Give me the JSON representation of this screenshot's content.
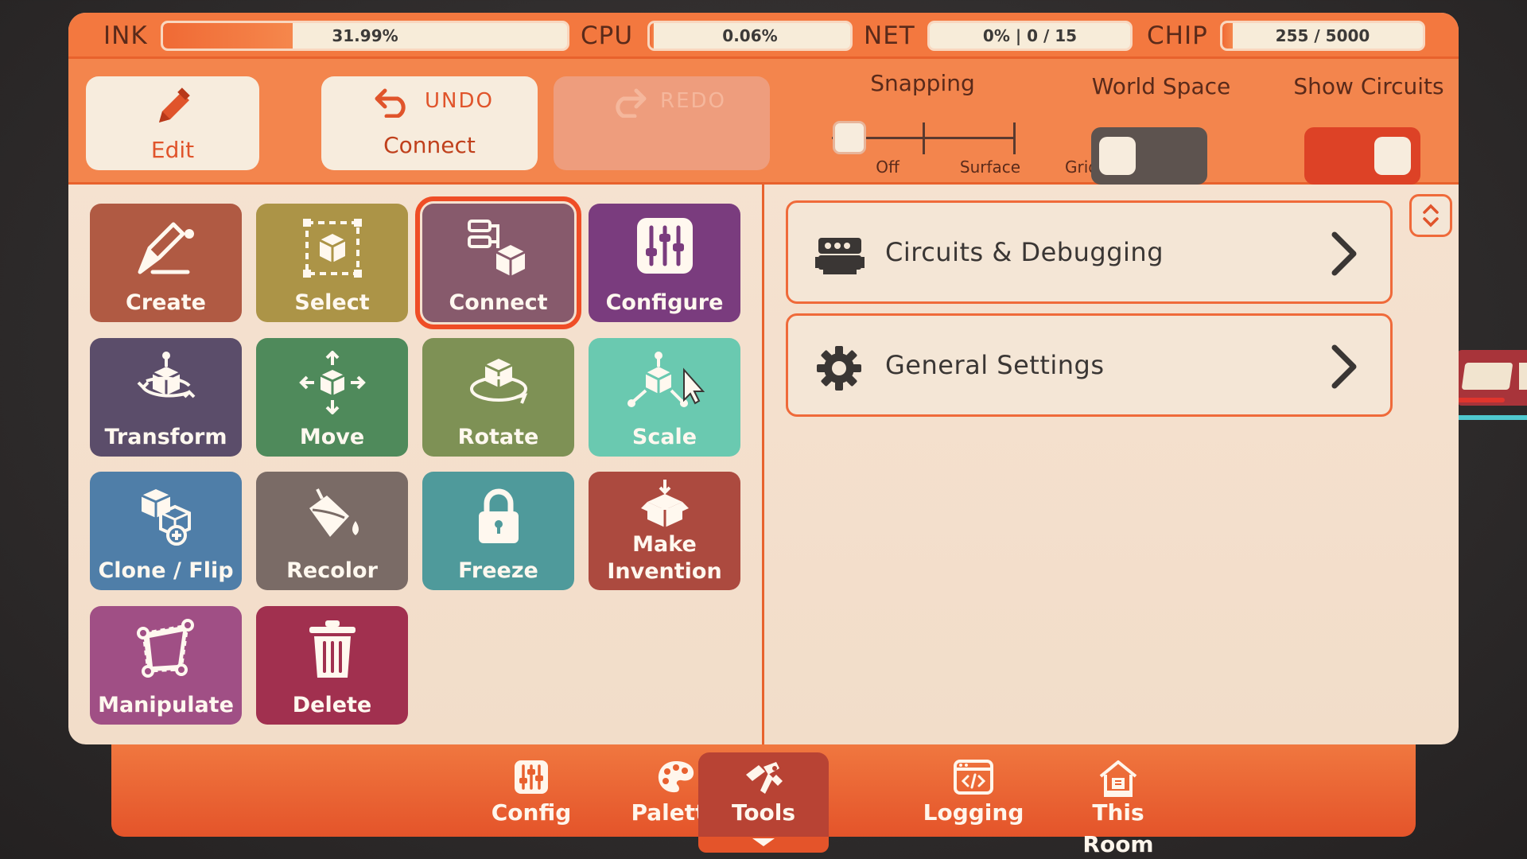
{
  "meters": {
    "ink": {
      "label": "INK",
      "value": "31.99%",
      "fill": 0.32
    },
    "cpu": {
      "label": "CPU",
      "value": "0.06%",
      "fill": 0.02
    },
    "net": {
      "label": "NET",
      "value": "0% | 0 / 15",
      "fill": 0.0
    },
    "chip": {
      "label": "CHIP",
      "value": "255 / 5000",
      "fill": 0.051
    }
  },
  "toolbar": {
    "edit_label": "Edit",
    "undo_label": "UNDO",
    "undo_action": "Connect",
    "redo_label": "REDO",
    "snapping": {
      "title": "Snapping",
      "options": [
        "Off",
        "Surface",
        "Grid"
      ],
      "selected": "Off"
    },
    "world_space": {
      "label": "World Space",
      "on": false
    },
    "show_circuits": {
      "label": "Show Circuits",
      "on": true
    }
  },
  "tools": [
    {
      "label": "Create",
      "color": "#b05a43"
    },
    {
      "label": "Select",
      "color": "#ac9447"
    },
    {
      "label": "Connect",
      "color": "#875a6c",
      "selected": true
    },
    {
      "label": "Configure",
      "color": "#7a3c7e"
    },
    {
      "label": "Transform",
      "color": "#5b4d6a"
    },
    {
      "label": "Move",
      "color": "#4f8a5b"
    },
    {
      "label": "Rotate",
      "color": "#7e9155"
    },
    {
      "label": "Scale",
      "color": "#6ac9b0"
    },
    {
      "label": "Clone / Flip",
      "color": "#4f7ea8"
    },
    {
      "label": "Recolor",
      "color": "#7a6b66"
    },
    {
      "label": "Freeze",
      "color": "#4f9a9b"
    },
    {
      "label": "Make Invention",
      "line1": "Make",
      "line2": "Invention",
      "color": "#ac4a3f"
    },
    {
      "label": "Manipulate",
      "color": "#a04f85"
    },
    {
      "label": "Delete",
      "color": "#a1304f"
    }
  ],
  "menu": [
    {
      "label": "Circuits & Debugging",
      "icon": "circuit-chip-icon"
    },
    {
      "label": "General Settings",
      "icon": "gear-icon"
    }
  ],
  "nav": [
    {
      "label": "Config",
      "icon": "sliders-icon"
    },
    {
      "label": "Palette",
      "icon": "palette-icon"
    },
    {
      "label": "Tools",
      "icon": "tools-icon",
      "active": true
    },
    {
      "label": "Logging",
      "icon": "code-window-icon"
    },
    {
      "label": "This Room",
      "icon": "house-icon"
    }
  ],
  "colors": {
    "accent": "#f3783f",
    "panel": "#f3e0cd",
    "toggle_off": "#5d534f",
    "toggle_on": "#dd4226"
  }
}
